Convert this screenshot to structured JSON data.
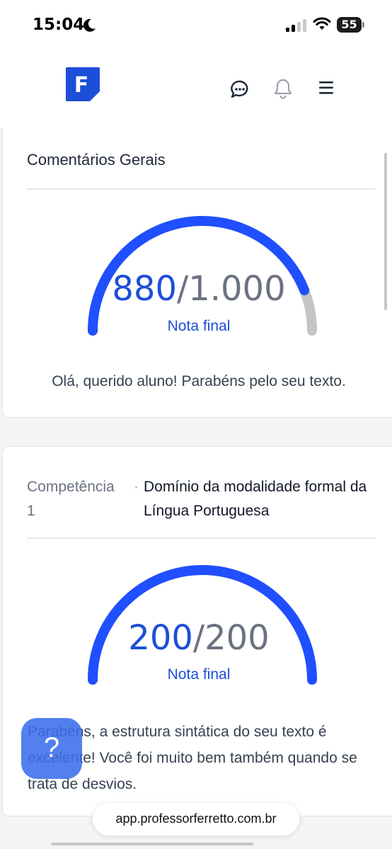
{
  "status_bar": {
    "time": "15:04",
    "battery": "55"
  },
  "header": {
    "logo_letter": "F",
    "brand_color": "#1d4ed8"
  },
  "general_card": {
    "title": "Comentários Gerais",
    "score": "880",
    "separator": "/",
    "max": "1.000",
    "score_fraction": 0.88,
    "caption": "Nota final",
    "comment": "Olá, querido aluno! Parabéns pelo seu texto."
  },
  "competence_card": {
    "label": "Competência",
    "number": "1",
    "separator_dot": "·",
    "title": "Domínio da modalidade formal da Língua Portuguesa",
    "score": "200",
    "separator": "/",
    "max": "200",
    "score_fraction": 1.0,
    "caption": "Nota final",
    "feedback": "Parabéns, a estrutura sintática do seu texto é excelente! Você foi muito bem também quando se trata de desvios."
  },
  "help_button": {
    "glyph": "?"
  },
  "browser": {
    "url": "app.professorferretto.com.br"
  },
  "colors": {
    "gauge_fill": "#1f4fff",
    "gauge_track": "#c4c4c4",
    "score_value": "#1d4ed8",
    "score_max": "#6b7280"
  }
}
